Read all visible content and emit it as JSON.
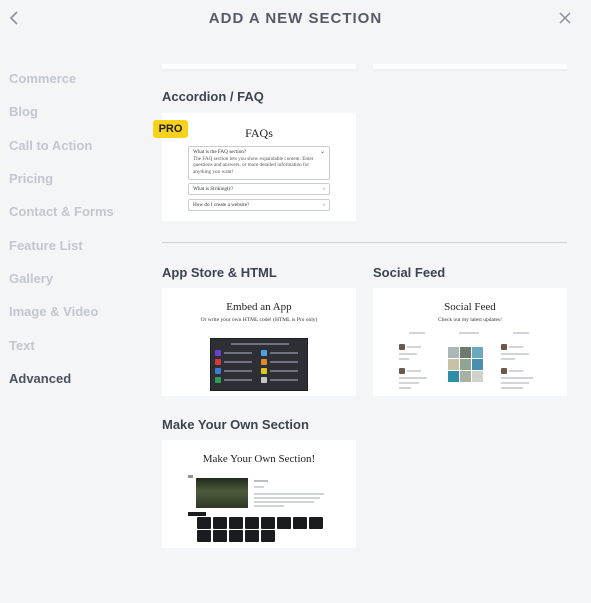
{
  "header": {
    "title": "ADD A NEW SECTION",
    "back_icon": "chevron-left-icon",
    "close_icon": "close-icon"
  },
  "sidebar": {
    "items": [
      {
        "label": "Commerce",
        "active": false
      },
      {
        "label": "Blog",
        "active": false
      },
      {
        "label": "Call to Action",
        "active": false
      },
      {
        "label": "Pricing",
        "active": false
      },
      {
        "label": "Contact & Forms",
        "active": false
      },
      {
        "label": "Feature List",
        "active": false
      },
      {
        "label": "Gallery",
        "active": false
      },
      {
        "label": "Image & Video",
        "active": false
      },
      {
        "label": "Text",
        "active": false
      },
      {
        "label": "Advanced",
        "active": true
      }
    ]
  },
  "sections": {
    "accordion": {
      "title": "Accordion / FAQ",
      "badge": "PRO",
      "preview": {
        "heading": "FAQs",
        "q1": "What is the FAQ section?",
        "q1_body": "The FAQ section lets you show expandable content. Enter questions and answers, or more detailed information for anything you want!",
        "q2": "What is Strikingly?",
        "q3": "How do I create a website?"
      }
    },
    "app_store": {
      "title": "App Store & HTML",
      "preview": {
        "heading": "Embed an App",
        "subtitle": "Or write your own HTML code! (HTML is Pro only)"
      }
    },
    "social_feed": {
      "title": "Social Feed",
      "preview": {
        "heading": "Social Feed",
        "subtitle": "Check out my latest updates!"
      }
    },
    "make_your_own": {
      "title": "Make Your Own Section",
      "preview": {
        "heading": "Make Your Own Section!"
      }
    }
  },
  "colors": {
    "background": "#f4f5f7",
    "card": "#ffffff",
    "badge": "#f7d21b",
    "active_text": "#4a5160",
    "inactive_text": "#c2c7cf"
  }
}
